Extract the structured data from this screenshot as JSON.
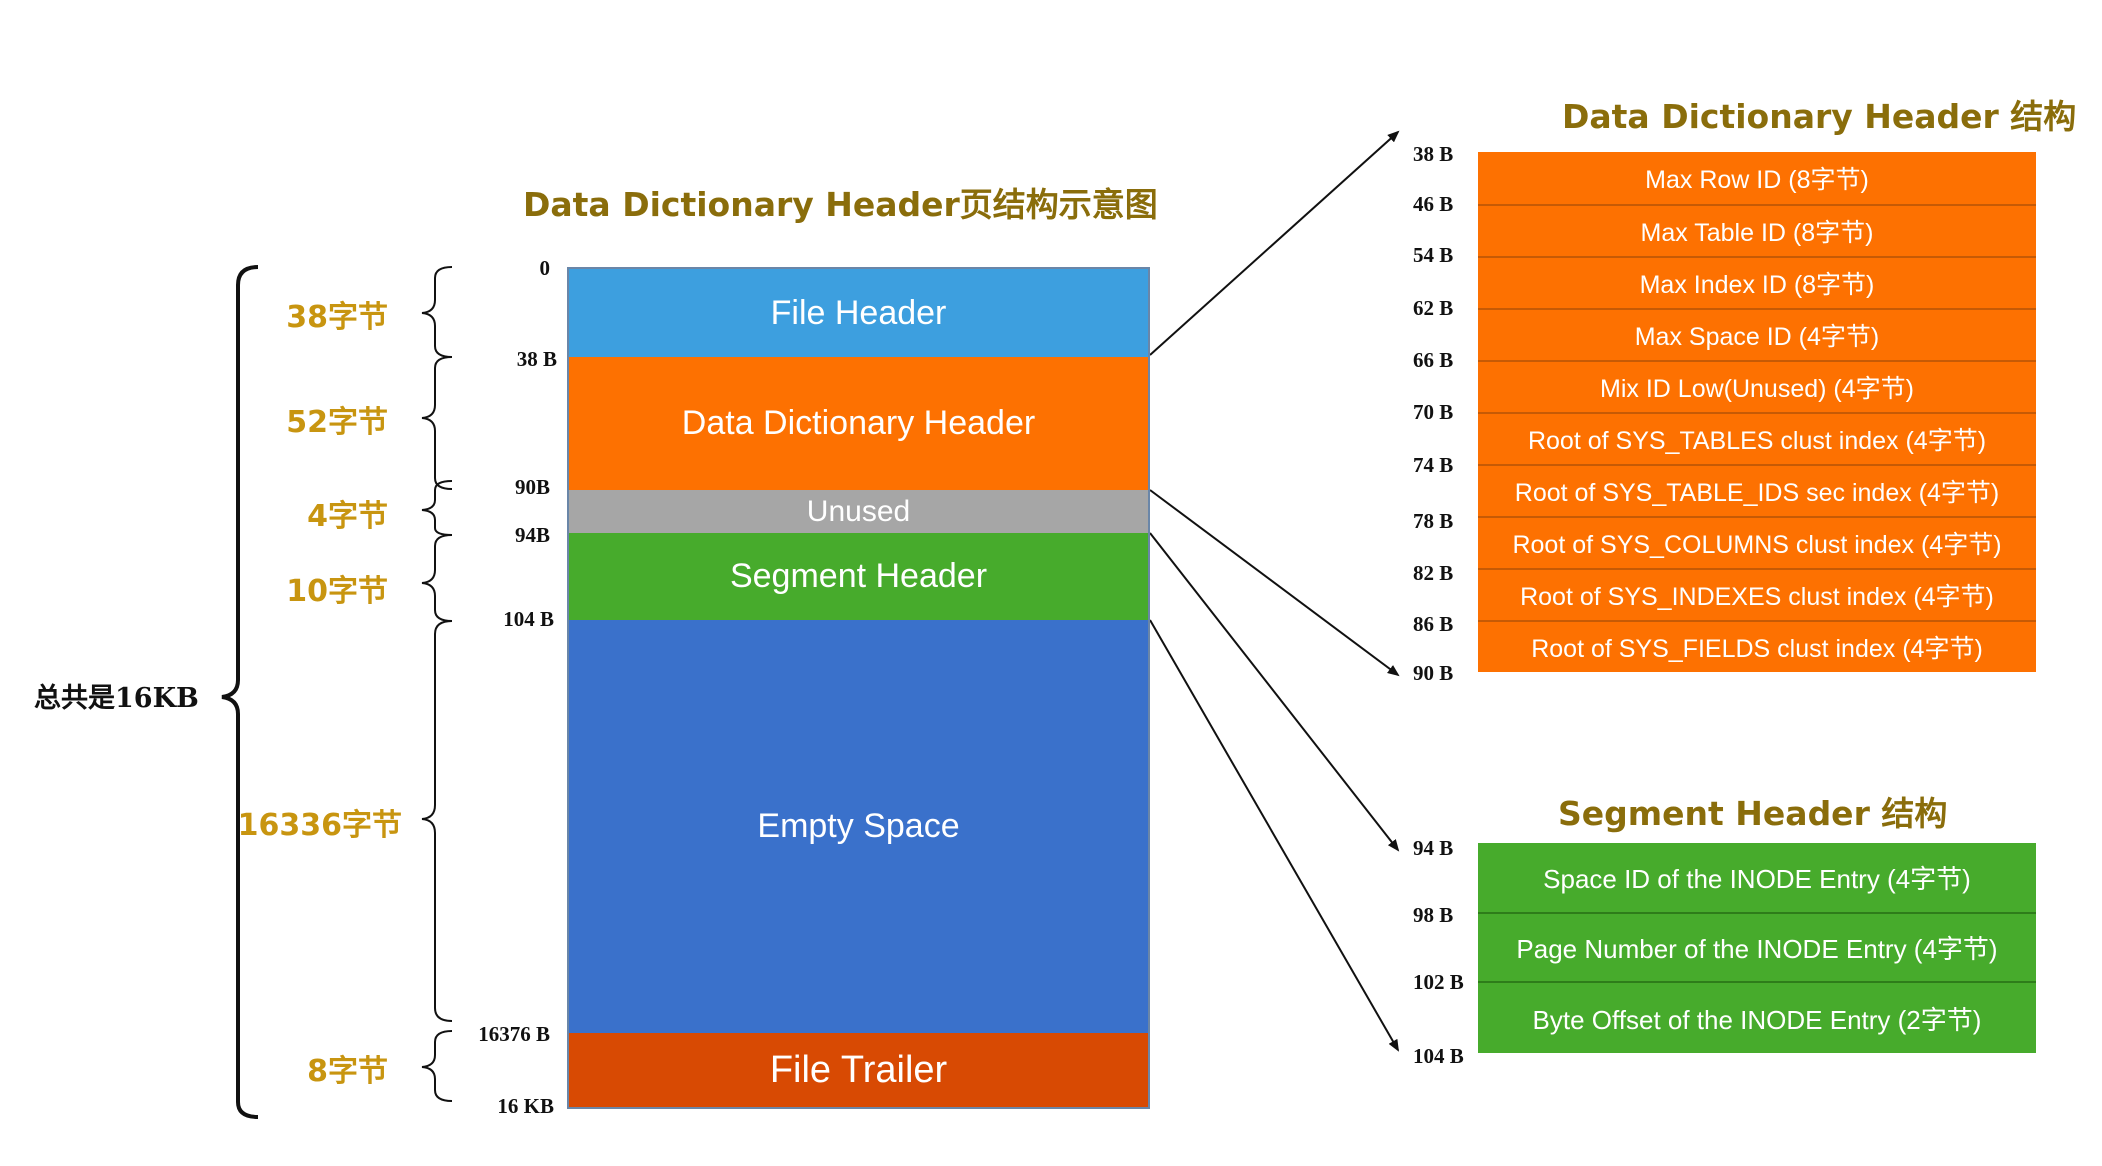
{
  "main_title": "Data Dictionary Header页结构示意图",
  "total_label": "总共是16KB",
  "blocks": [
    {
      "label": "File Header",
      "color": "#3d9fdf"
    },
    {
      "label": "Data Dictionary Header",
      "color": "#fd7101"
    },
    {
      "label": "Unused",
      "color": "#a6a6a6"
    },
    {
      "label": "Segment Header",
      "color": "#47ab2c"
    },
    {
      "label": "Empty Space",
      "color": "#3a71cb"
    },
    {
      "label": "File Trailer",
      "color": "#d84a03"
    }
  ],
  "page_offsets": [
    "0",
    "38 B",
    "90B",
    "94B",
    "104 B",
    "16376 B",
    "16 KB"
  ],
  "sizes": [
    "38字节",
    "52字节",
    "4字节",
    "10字节",
    "16336字节",
    "8字节"
  ],
  "dd_header": {
    "title": "Data Dictionary Header 结构",
    "offsets": [
      "38 B",
      "46 B",
      "54 B",
      "62 B",
      "66 B",
      "70 B",
      "74 B",
      "78 B",
      "82 B",
      "86 B",
      "90 B"
    ],
    "fields": [
      "Max Row ID (8字节)",
      "Max Table ID (8字节)",
      "Max Index ID (8字节)",
      "Max Space ID (4字节)",
      "Mix ID Low(Unused) (4字节)",
      "Root of SYS_TABLES clust index (4字节)",
      "Root of SYS_TABLE_IDS sec index (4字节)",
      "Root of SYS_COLUMNS clust index (4字节)",
      "Root of SYS_INDEXES clust index (4字节)",
      "Root of SYS_FIELDS clust index (4字节)"
    ]
  },
  "segment_header": {
    "title": "Segment Header 结构",
    "offsets": [
      "94 B",
      "98 B",
      "102 B",
      "104 B"
    ],
    "fields": [
      "Space ID of the INODE Entry (4字节)",
      "Page Number of the INODE Entry (4字节)",
      "Byte Offset of the INODE Entry (2字节)"
    ]
  }
}
